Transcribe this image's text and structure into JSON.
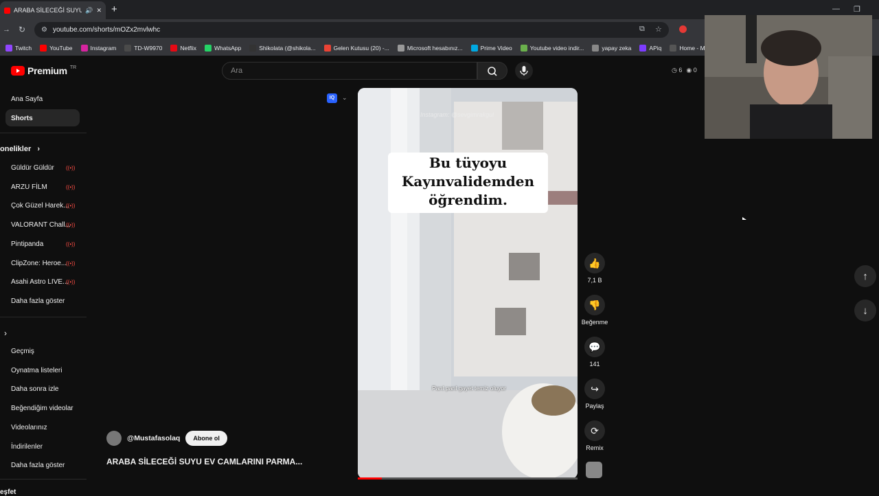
{
  "browser": {
    "tab_title": "ARABA SİLECEĞİ SUYU EV C",
    "url": "youtube.com/shorts/mOZx2mvlwhc",
    "bookmarks": [
      "Twitch",
      "YouTube",
      "Instagram",
      "TD-W9970",
      "Netflix",
      "WhatsApp",
      "Shikolata (@shikola...",
      "Gelen Kutusu (20) -...",
      "Microsoft hesabınız...",
      "Prime Video",
      "Youtube video indir...",
      "yapay zeka",
      "APiq",
      "Home - Mar"
    ]
  },
  "header": {
    "brand": "Premium",
    "region": "TR",
    "search_placeholder": "Ara",
    "stat_a": "6",
    "stat_b": "0"
  },
  "sidebar": {
    "home": "Ana Sayfa",
    "shorts": "Shorts",
    "subs_header": "onelikler",
    "subs": [
      "Güldür Güldür",
      "ARZU FİLM",
      "Çok Güzel Harek...",
      "VALORANT Chall...",
      "Pintipanda",
      "ClipZone: Heroe...",
      "Asahi Astro LIVE..."
    ],
    "show_more": "Daha fazla göster",
    "you": [
      "Geçmiş",
      "Oynatma listeleri",
      "Daha sonra izle",
      "Beğendiğim videolar",
      "Videolarınız",
      "İndirilenler"
    ],
    "show_more_2": "Daha fazla göster",
    "bottom_cut": "eşfet"
  },
  "video": {
    "watermark": "Instagram: @sevgimrakgul",
    "caption": "Bu tüyoyu Kayınvalidemden öğrendim.",
    "subtitle": "Parıl parıl gayet temiz oluyor",
    "progress": 0.11
  },
  "actions": {
    "likes": "7,1 B",
    "dislike": "Beğenme",
    "comments": "141",
    "share": "Paylaş",
    "remix": "Remix"
  },
  "channel": {
    "handle": "@Mustafasolaq",
    "subscribe": "Abone ol"
  },
  "title": "ARABA SİLECEĞİ SUYU EV CAMLARINI PARMA..."
}
